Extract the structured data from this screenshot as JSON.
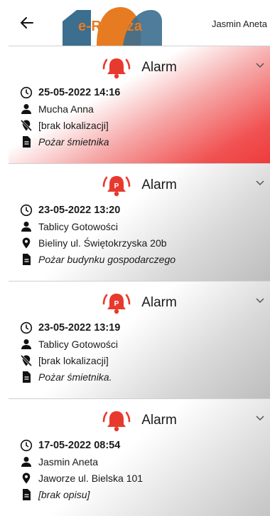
{
  "header": {
    "logo_text": "e-Remiza",
    "user_name": "Jasmin Aneta"
  },
  "alarms": [
    {
      "title": "Alarm",
      "icon": "bell-icon",
      "date": "25-05-2022 14:16",
      "person": "Mucha Anna",
      "location": "[brak lokalizacji]",
      "location_icon": "location-off-icon",
      "description": "Pożar śmietnika",
      "color": "#f04545"
    },
    {
      "title": "Alarm",
      "icon": "bell-p-icon",
      "date": "23-05-2022 13:20",
      "person": "Tablicy Gotowości",
      "location": "Bieliny ul. Świętokrzyska  20b",
      "location_icon": "location-pin-icon",
      "description": "Pożar budynku gospodarczego",
      "color": "#bdbdbd"
    },
    {
      "title": "Alarm",
      "icon": "bell-p-icon",
      "date": "23-05-2022 13:19",
      "person": "Tablicy Gotowości",
      "location": "[brak lokalizacji]",
      "location_icon": "location-off-icon",
      "description": "Pożar śmietnika.",
      "color": "#bdbdbd"
    },
    {
      "title": "Alarm",
      "icon": "bell-icon",
      "date": "17-05-2022 08:54",
      "person": "Jasmin Aneta",
      "location": "Jaworze ul. Bielska 101",
      "location_icon": "location-pin-icon",
      "description": "[brak opisu]",
      "color": "#c4c4c4"
    }
  ],
  "colors": {
    "bell": "#e8392e",
    "logo_orange": "#e77b22",
    "logo_blue": "#3b6e8f"
  }
}
